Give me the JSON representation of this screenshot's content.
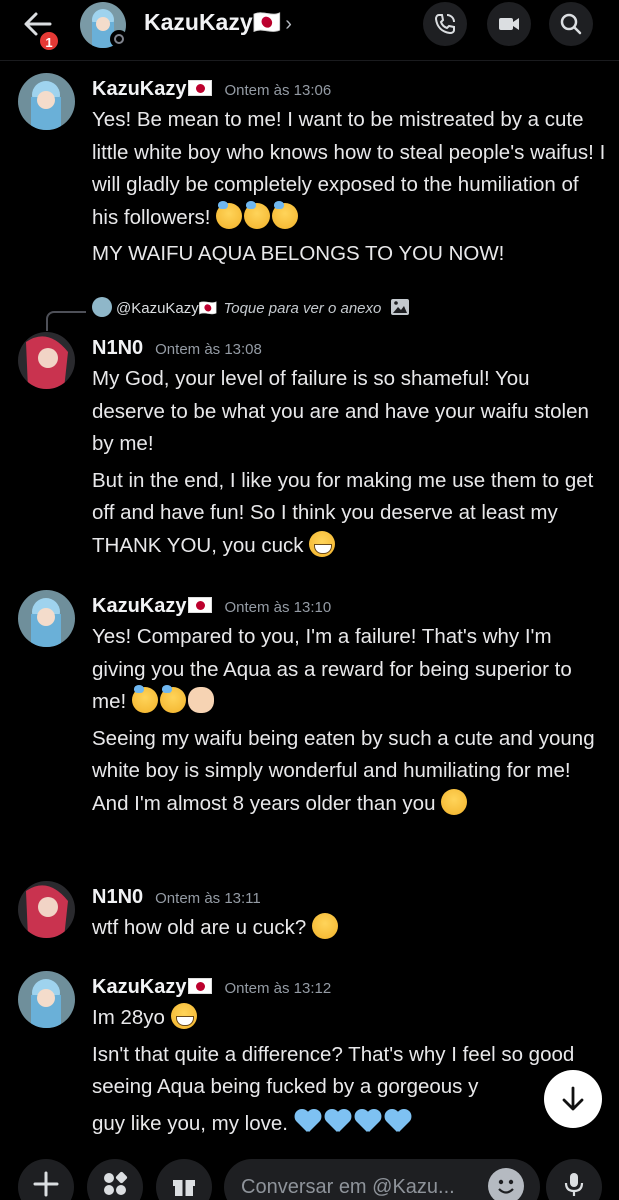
{
  "header": {
    "title": "KazuKazy🇯🇵",
    "unread_badge": "1",
    "chevron": "›",
    "icons": [
      "back-arrow-icon",
      "phone-call-icon",
      "video-camera-icon",
      "search-icon"
    ]
  },
  "reply": {
    "name": "@KazuKazy🇯🇵",
    "text": "Toque para ver o anexo"
  },
  "messages": [
    {
      "author": "KazuKazy",
      "time": "Ontem às 13:06",
      "lines": [
        "Yes! Be mean to me! I want to be mistreated by a cute little white boy who knows how to steal people's waifus! I will gladly be completely exposed to the humiliation of his followers!",
        "MY WAIFU AQUA BELONGS TO YOU NOW!"
      ]
    },
    {
      "author": "N1N0",
      "time": "Ontem às 13:08",
      "lines": [
        "My God, your level of failure is so shameful! You deserve to be what you are and have your waifu stolen by me!",
        "But in the end, I like you for making me use them to get off and have fun! So I think you deserve at least my THANK YOU, you cuck"
      ]
    },
    {
      "author": "KazuKazy",
      "time": "Ontem às 13:10",
      "lines": [
        "Yes! Compared to you, I'm a failure! That's why I'm giving you the Aqua as a reward for being superior to me!",
        "Seeing my waifu being eaten by such a cute and young white boy is simply wonderful and humiliating for me! And I'm almost 8 years older than you"
      ]
    },
    {
      "author": "N1N0",
      "time": "Ontem às 13:11",
      "lines": [
        "wtf how old are u cuck?"
      ]
    },
    {
      "author": "KazuKazy",
      "time": "Ontem às 13:12",
      "lines": [
        "Im 28yo",
        "Isn't that quite a difference? That's why I feel so good seeing Aqua being fucked by a gorgeous y",
        "guy like you, my love."
      ]
    }
  ],
  "composer": {
    "placeholder": "Conversar em @Kazu...",
    "icons": [
      "plus-icon",
      "apps-icon",
      "gift-icon",
      "emoji-icon",
      "microphone-icon"
    ]
  },
  "colors": {
    "background": "#000000",
    "text": "#e8e8ea",
    "timestamp": "#949ba4",
    "badge": "#e53935",
    "button_bg": "#1e1f22"
  }
}
